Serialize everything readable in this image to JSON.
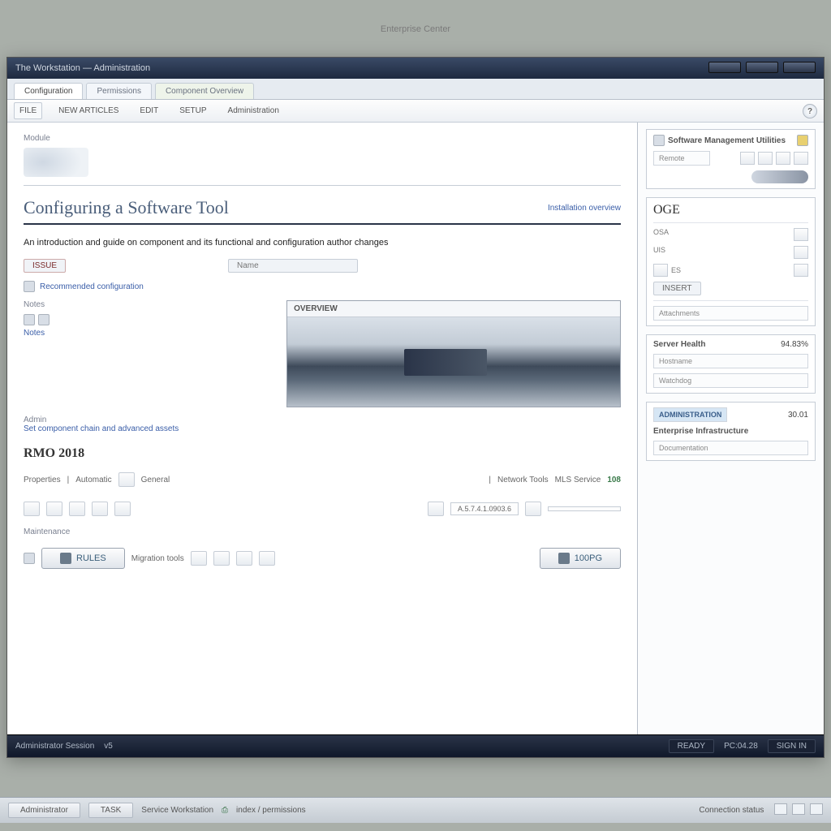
{
  "outer_label": "Enterprise Center",
  "window": {
    "title": "The Workstation — Administration",
    "tabs": [
      "Configuration",
      "Permissions",
      "Component Overview"
    ],
    "menu": [
      "FILE",
      "NEW ARTICLES",
      "EDIT",
      "SETUP",
      "Administration"
    ],
    "win_buttons": [
      "min",
      "max",
      "close"
    ]
  },
  "main": {
    "section_top_label": "Module",
    "article_title": "Configuring a Software Tool",
    "breadcrumb_right": "Installation overview",
    "lead_text": "An introduction and guide on component and its functional and configuration author changes",
    "tag": "ISSUE",
    "config_link": "Recommended configuration",
    "mid_input_placeholder": "Name",
    "notes_label": "Notes",
    "notes_link": "Notes",
    "figure_caption": "OVERVIEW",
    "admin_label": "Admin",
    "admin_link": "Set component chain and advanced assets",
    "section_title": "RMO 2018",
    "list_row": {
      "label1": "Properties",
      "chk1": "Automatic",
      "chk2": "General",
      "mid1": "Network Tools",
      "mid2": "MLS Service",
      "value": "108"
    },
    "bar_value": "A.5.7.4.1.0903.6",
    "sub_label": "Maintenance",
    "btn_primary": "RULES",
    "btn_secondary_label": "Migration tools",
    "btn_action": "100PG"
  },
  "sidebar": {
    "panel1_title": "Software Management Utilities",
    "panel1_tab": "Remote",
    "panel2_title": "OGE",
    "panel2_items": [
      "OSA",
      "UIS",
      "ES"
    ],
    "panel2_btn": "INSERT",
    "panel3_label": "Attachments",
    "panel4_title": "Server Health",
    "panel4_value": "94.83%",
    "panel4_field1": "Hostname",
    "panel4_field2": "Watchdog",
    "panel5_hl": "ADMINISTRATION",
    "panel5_val": "30.01",
    "panel5_sub": "Enterprise Infrastructure",
    "panel5_field": "Documentation"
  },
  "statusbar": {
    "left1": "Administrator Session",
    "left2": "v5",
    "r1": "READY",
    "r2": "PC:04.28",
    "r3": "SIGN IN"
  },
  "taskbar": {
    "b1": "Administrator",
    "b2": "TASK",
    "b3": "Service Workstation",
    "b4_icon_label": "index / permissions",
    "mid": "Connection status"
  }
}
